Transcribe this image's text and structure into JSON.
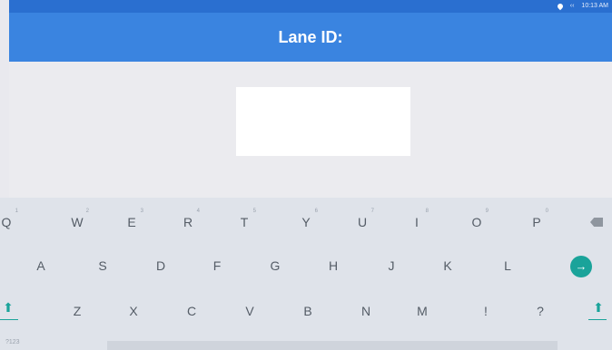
{
  "status_bar": {
    "time": "10:13 AM",
    "icons": [
      "location-icon",
      "signal-icon"
    ]
  },
  "app_bar": {
    "title": "Lane ID:"
  },
  "input": {
    "value": "",
    "placeholder": ""
  },
  "keyboard": {
    "row1": [
      {
        "label": "Q",
        "hint": "1"
      },
      {
        "label": "W",
        "hint": "2"
      },
      {
        "label": "E",
        "hint": "3"
      },
      {
        "label": "R",
        "hint": "4"
      },
      {
        "label": "T",
        "hint": "5"
      },
      {
        "label": "Y",
        "hint": "6"
      },
      {
        "label": "U",
        "hint": "7"
      },
      {
        "label": "I",
        "hint": "8"
      },
      {
        "label": "O",
        "hint": "9"
      },
      {
        "label": "P",
        "hint": "0"
      }
    ],
    "row2": [
      "A",
      "S",
      "D",
      "F",
      "G",
      "H",
      "J",
      "K",
      "L"
    ],
    "row3": [
      "Z",
      "X",
      "C",
      "V",
      "B",
      "N",
      "M",
      "!",
      "?"
    ],
    "symbols_key": "?123"
  },
  "colors": {
    "app_bar": "#3a84e0",
    "status_bar": "#2a6fd0",
    "accent": "#1aa39a"
  }
}
